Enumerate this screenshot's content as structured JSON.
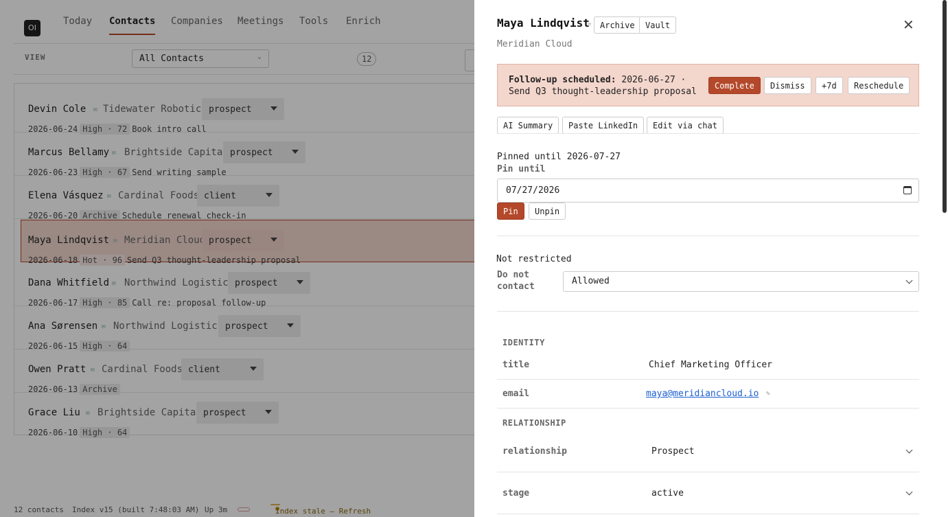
{
  "nav": {
    "logo": "OI",
    "tabs": [
      "Today",
      "Contacts",
      "Companies",
      "Meetings",
      "Tools",
      "Enrich"
    ],
    "active_tab": "Contacts"
  },
  "view_bar": {
    "label": "VIEW",
    "selected_view": "All Contacts",
    "count": "12"
  },
  "contacts": [
    {
      "name": "Devin Cole",
      "company": "Tidewater Robotics",
      "stage": "prospect",
      "date": "2026-06-24",
      "priority": "High · 72",
      "action": "Book intro call"
    },
    {
      "name": "Marcus Bellamy",
      "company": "Brightside Capital",
      "stage": "prospect",
      "date": "2026-06-23",
      "priority": "High · 67",
      "action": "Send writing sample"
    },
    {
      "name": "Elena Vásquez",
      "company": "Cardinal Foods",
      "stage": "client",
      "date": "2026-06-20",
      "priority": "Archive",
      "action": "Schedule renewal check-in"
    },
    {
      "name": "Maya Lindqvist",
      "company": "Meridian Cloud",
      "stage": "prospect",
      "date": "2026-06-18",
      "priority": "Hot · 96",
      "action": "Send Q3 thought-leadership proposal"
    },
    {
      "name": "Dana Whitfield",
      "company": "Northwind Logistics",
      "stage": "prospect",
      "date": "2026-06-17",
      "priority": "High · 85",
      "action": "Call re: proposal follow-up"
    },
    {
      "name": "Ana Sørensen",
      "company": "Northwind Logistics",
      "stage": "prospect",
      "date": "2026-06-15",
      "priority": "High · 64",
      "action": ""
    },
    {
      "name": "Owen Pratt",
      "company": "Cardinal Foods",
      "stage": "client",
      "date": "2026-06-13",
      "priority": "Archive",
      "action": ""
    },
    {
      "name": "Grace Liu",
      "company": "Brightside Capital",
      "stage": "prospect",
      "date": "2026-06-10",
      "priority": "High · 64",
      "action": ""
    }
  ],
  "status_bar": {
    "contacts": "12 contacts",
    "index": "Index v15 (built 7:48:03 AM)",
    "uptime": "Up 3m",
    "stale": "Index stale — Refresh"
  },
  "drawer": {
    "name": "Maya Lindqvist",
    "chips": [
      "Archive",
      "Vault"
    ],
    "company": "Meridian Cloud",
    "followup": {
      "label": "Follow-up scheduled:",
      "text": "2026-06-27 · Send Q3 thought-leadership proposal",
      "buttons": [
        "Complete",
        "Dismiss",
        "+7d",
        "Reschedule"
      ]
    },
    "actions": [
      "AI Summary",
      "Paste LinkedIn",
      "Edit via chat"
    ],
    "pin": {
      "status": "Pinned until 2026-07-27",
      "label": "Pin until",
      "date_value": "07/27/2026",
      "pin_button": "Pin",
      "unpin_button": "Unpin"
    },
    "restriction": {
      "status": "Not restricted",
      "label": "Do not contact",
      "value": "Allowed"
    },
    "identity": {
      "heading": "IDENTITY",
      "title_key": "title",
      "title_value": "Chief Marketing Officer",
      "email_key": "email",
      "email_value": "maya@meridiancloud.io"
    },
    "relationship": {
      "heading": "RELATIONSHIP",
      "relationship_key": "relationship",
      "relationship_value": "Prospect",
      "stage_key": "stage",
      "stage_value": "active"
    }
  },
  "colors": {
    "accent": "#b4482a",
    "followup_bg": "#f3d6cc",
    "link": "#1a5fd1"
  }
}
